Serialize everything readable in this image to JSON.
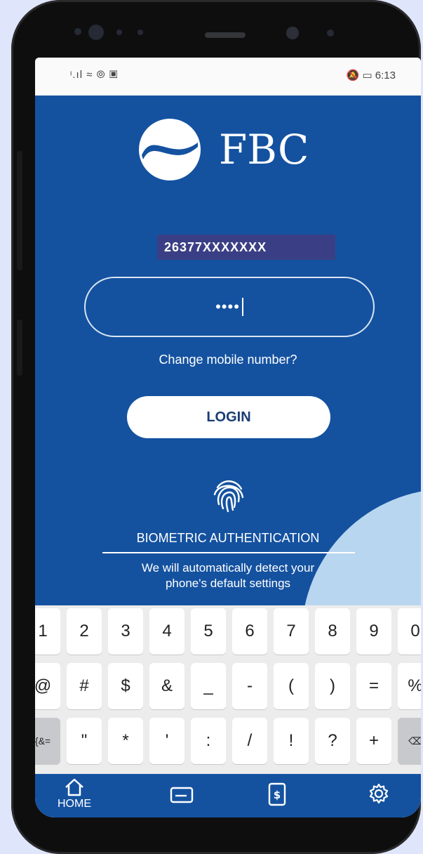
{
  "status_bar": {
    "left_icons": "ᶦ.ıl ≈ ⦾ ▣",
    "right_text": "🔕 ▭ 6:13"
  },
  "logo": {
    "text": "FBC"
  },
  "login": {
    "phone_number": "26377XXXXXXX",
    "pin_masked": "••••",
    "change_number_link": "Change mobile number?",
    "login_button": "LOGIN"
  },
  "biometric": {
    "title": "BIOMETRIC AUTHENTICATION",
    "subtitle_line1": "We will automatically detect your",
    "subtitle_line2": "phone's default settings"
  },
  "keyboard": {
    "row1": [
      "1",
      "2",
      "3",
      "4",
      "5",
      "6",
      "7",
      "8",
      "9",
      "0"
    ],
    "row2": [
      "@",
      "#",
      "$",
      "&",
      "_",
      "-",
      "(",
      ")",
      "=",
      "%"
    ],
    "row3": [
      "{&=",
      "\"",
      "*",
      "'",
      ":",
      "/",
      "!",
      "?",
      "+",
      "⌫"
    ]
  },
  "bottom_nav": {
    "home_label": "HOME",
    "items": [
      "home-icon",
      "card-icon",
      "mobile-dollar-icon",
      "gear-icon"
    ]
  },
  "colors": {
    "primary_blue": "#1452a0",
    "accent_light_blue": "#b9d6f0",
    "phone_field_bg": "#3a3f85"
  }
}
